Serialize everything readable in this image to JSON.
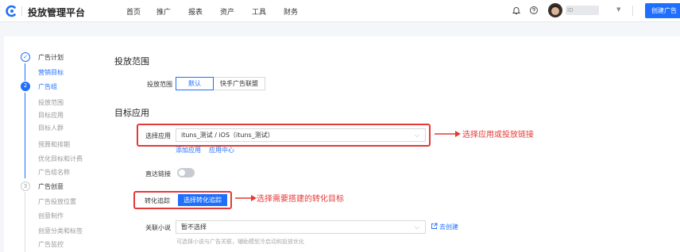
{
  "header": {
    "brand": "投放管理平台",
    "nav": [
      "首页",
      "推广",
      "报表",
      "资产",
      "工具",
      "财务"
    ],
    "account_name": "ID",
    "create_button": "创建广告"
  },
  "steps": [
    {
      "index": "✓",
      "title": "广告计划",
      "status": "done",
      "subs": [
        "营销目标"
      ]
    },
    {
      "index": "2",
      "title": "广告组",
      "status": "active",
      "subs": [
        "投放范围",
        "目标应用",
        "目标人群",
        "预算和排期",
        "优化目标和计费",
        "广告组名称"
      ]
    },
    {
      "index": "3",
      "title": "广告创意",
      "status": "todo",
      "subs": [
        "广告投放位置",
        "创意制作",
        "创意分类和标签",
        "广告监控"
      ]
    }
  ],
  "scope": {
    "section_title": "投放范围",
    "label": "投放范围",
    "options": [
      "默认",
      "快手广告联盟"
    ],
    "selected": "默认"
  },
  "target_app": {
    "section_title": "目标应用",
    "label": "选择应用",
    "value": "ituns_测试 / iOS（ituns_测试）",
    "add_link": "添加应用",
    "center_link": "应用中心"
  },
  "direct_link": {
    "label": "直达链接",
    "enabled": false
  },
  "conversion": {
    "label": "转化追踪",
    "button": "选择转化追踪"
  },
  "novel": {
    "label": "关联小说",
    "value": "暂不选择",
    "create_link": "去创建",
    "hint": "可选择小说与广告关联，辅助模型冷启动和投放优化"
  },
  "annotations": {
    "app_note": "选择应用或投放链接",
    "conversion_note": "选择需要搭建的转化目标"
  },
  "colors": {
    "primary": "#1f6fff",
    "annotation": "#e53935"
  }
}
